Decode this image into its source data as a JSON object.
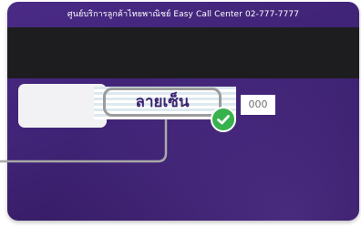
{
  "card": {
    "hotline_text": "ศูนย์บริการลูกค้าไทยพาณิชย์ Easy Call Center 02-777-7777",
    "signature_label": "ลายเซ็น",
    "cvv_placeholder": "000"
  },
  "colors": {
    "card_purple": "#4a2a86",
    "magstripe": "#1d1d1f",
    "signature_text": "#3b246f",
    "highlight_border": "#9c9c9c",
    "check_green": "#37b24d"
  },
  "icons": {
    "check": "check-icon"
  }
}
